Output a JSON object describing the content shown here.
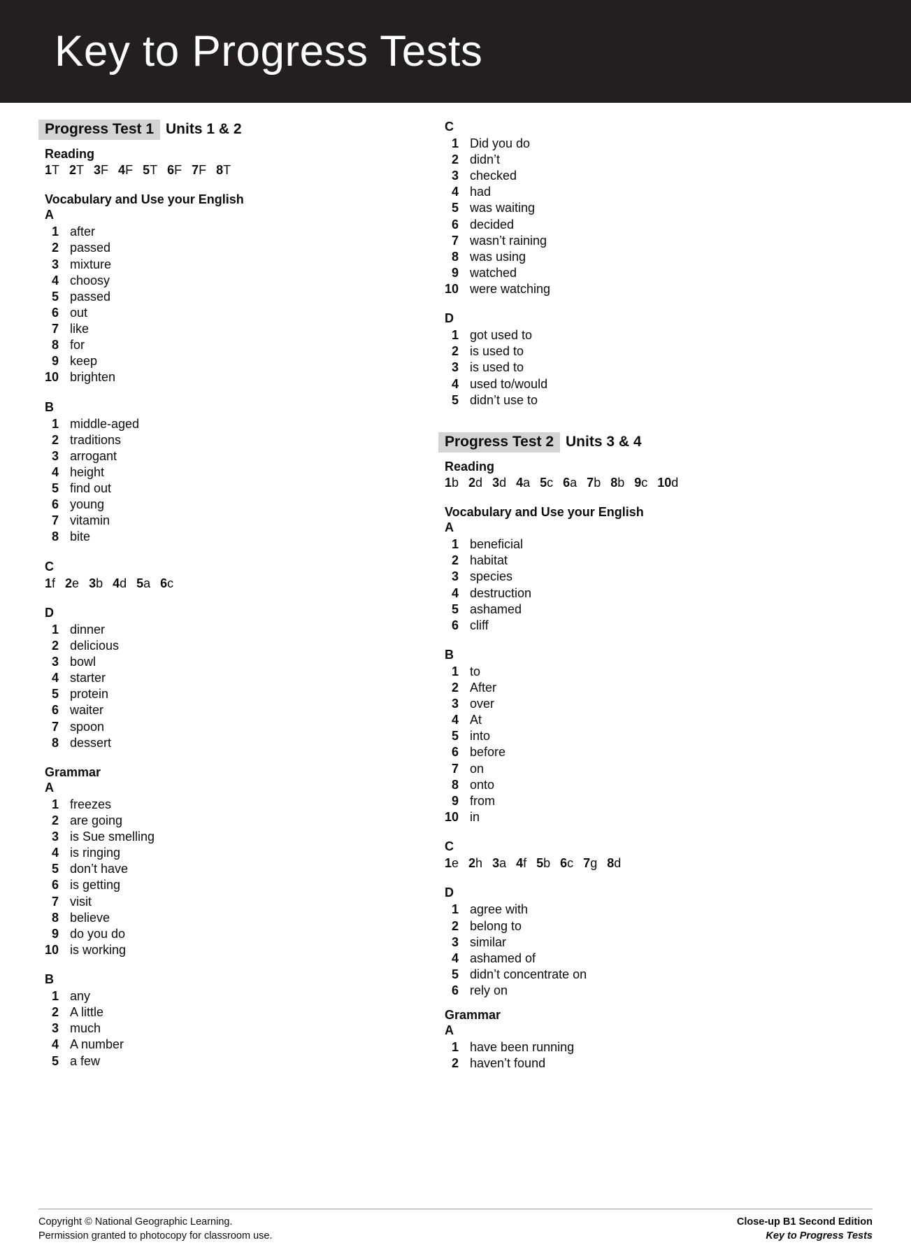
{
  "header": {
    "title": "Key to Progress Tests"
  },
  "tests": [
    {
      "chip": "Progress Test 1",
      "units": "Units 1 & 2",
      "reading_heading": "Reading",
      "reading_answers": [
        {
          "n": "1",
          "a": "T"
        },
        {
          "n": "2",
          "a": "T"
        },
        {
          "n": "3",
          "a": "F"
        },
        {
          "n": "4",
          "a": "F"
        },
        {
          "n": "5",
          "a": "T"
        },
        {
          "n": "6",
          "a": "F"
        },
        {
          "n": "7",
          "a": "F"
        },
        {
          "n": "8",
          "a": "T"
        }
      ],
      "vocab_heading": "Vocabulary and Use your English",
      "vocab_A_letter": "A",
      "vocab_A": [
        {
          "n": "1",
          "a": "after"
        },
        {
          "n": "2",
          "a": "passed"
        },
        {
          "n": "3",
          "a": "mixture"
        },
        {
          "n": "4",
          "a": "choosy"
        },
        {
          "n": "5",
          "a": "passed"
        },
        {
          "n": "6",
          "a": "out"
        },
        {
          "n": "7",
          "a": "like"
        },
        {
          "n": "8",
          "a": "for"
        },
        {
          "n": "9",
          "a": "keep"
        },
        {
          "n": "10",
          "a": "brighten"
        }
      ],
      "vocab_B_letter": "B",
      "vocab_B": [
        {
          "n": "1",
          "a": "middle-aged"
        },
        {
          "n": "2",
          "a": "traditions"
        },
        {
          "n": "3",
          "a": "arrogant"
        },
        {
          "n": "4",
          "a": "height"
        },
        {
          "n": "5",
          "a": "find out"
        },
        {
          "n": "6",
          "a": "young"
        },
        {
          "n": "7",
          "a": "vitamin"
        },
        {
          "n": "8",
          "a": "bite"
        }
      ],
      "vocab_C_letter": "C",
      "vocab_C": [
        {
          "n": "1",
          "a": "f"
        },
        {
          "n": "2",
          "a": "e"
        },
        {
          "n": "3",
          "a": "b"
        },
        {
          "n": "4",
          "a": "d"
        },
        {
          "n": "5",
          "a": "a"
        },
        {
          "n": "6",
          "a": "c"
        }
      ],
      "vocab_D_letter": "D",
      "vocab_D": [
        {
          "n": "1",
          "a": "dinner"
        },
        {
          "n": "2",
          "a": "delicious"
        },
        {
          "n": "3",
          "a": "bowl"
        },
        {
          "n": "4",
          "a": "starter"
        },
        {
          "n": "5",
          "a": "protein"
        },
        {
          "n": "6",
          "a": "waiter"
        },
        {
          "n": "7",
          "a": "spoon"
        },
        {
          "n": "8",
          "a": "dessert"
        }
      ],
      "grammar_heading": "Grammar",
      "grammar_A_letter": "A",
      "grammar_A": [
        {
          "n": "1",
          "a": "freezes"
        },
        {
          "n": "2",
          "a": "are going"
        },
        {
          "n": "3",
          "a": "is Sue smelling"
        },
        {
          "n": "4",
          "a": "is ringing"
        },
        {
          "n": "5",
          "a": "don’t have"
        },
        {
          "n": "6",
          "a": "is getting"
        },
        {
          "n": "7",
          "a": "visit"
        },
        {
          "n": "8",
          "a": "believe"
        },
        {
          "n": "9",
          "a": "do you do"
        },
        {
          "n": "10",
          "a": "is working"
        }
      ],
      "grammar_B_letter": "B",
      "grammar_B": [
        {
          "n": "1",
          "a": "any"
        },
        {
          "n": "2",
          "a": "A little"
        },
        {
          "n": "3",
          "a": "much"
        },
        {
          "n": "4",
          "a": "A number"
        },
        {
          "n": "5",
          "a": "a few"
        }
      ],
      "grammar_C_letter": "C",
      "grammar_C": [
        {
          "n": "1",
          "a": "Did you do"
        },
        {
          "n": "2",
          "a": "didn’t"
        },
        {
          "n": "3",
          "a": "checked"
        },
        {
          "n": "4",
          "a": "had"
        },
        {
          "n": "5",
          "a": "was waiting"
        },
        {
          "n": "6",
          "a": "decided"
        },
        {
          "n": "7",
          "a": "wasn’t raining"
        },
        {
          "n": "8",
          "a": "was using"
        },
        {
          "n": "9",
          "a": "watched"
        },
        {
          "n": "10",
          "a": "were watching"
        }
      ],
      "grammar_D_letter": "D",
      "grammar_D": [
        {
          "n": "1",
          "a": "got used to"
        },
        {
          "n": "2",
          "a": "is used to"
        },
        {
          "n": "3",
          "a": "is used to"
        },
        {
          "n": "4",
          "a": "used to/would"
        },
        {
          "n": "5",
          "a": "didn’t use to"
        }
      ]
    },
    {
      "chip": "Progress Test 2",
      "units": "Units 3 & 4",
      "reading_heading": "Reading",
      "reading_answers": [
        {
          "n": "1",
          "a": "b"
        },
        {
          "n": "2",
          "a": "d"
        },
        {
          "n": "3",
          "a": "d"
        },
        {
          "n": "4",
          "a": "a"
        },
        {
          "n": "5",
          "a": "c"
        },
        {
          "n": "6",
          "a": "a"
        },
        {
          "n": "7",
          "a": "b"
        },
        {
          "n": "8",
          "a": "b"
        },
        {
          "n": "9",
          "a": "c"
        },
        {
          "n": "10",
          "a": "d"
        }
      ],
      "vocab_heading": "Vocabulary and Use your English",
      "vocab_A_letter": "A",
      "vocab_A": [
        {
          "n": "1",
          "a": "beneficial"
        },
        {
          "n": "2",
          "a": "habitat"
        },
        {
          "n": "3",
          "a": "species"
        },
        {
          "n": "4",
          "a": "destruction"
        },
        {
          "n": "5",
          "a": "ashamed"
        },
        {
          "n": "6",
          "a": "cliff"
        }
      ],
      "vocab_B_letter": "B",
      "vocab_B": [
        {
          "n": "1",
          "a": "to"
        },
        {
          "n": "2",
          "a": "After"
        },
        {
          "n": "3",
          "a": "over"
        },
        {
          "n": "4",
          "a": "At"
        },
        {
          "n": "5",
          "a": "into"
        },
        {
          "n": "6",
          "a": "before"
        },
        {
          "n": "7",
          "a": "on"
        },
        {
          "n": "8",
          "a": "onto"
        },
        {
          "n": "9",
          "a": "from"
        },
        {
          "n": "10",
          "a": "in"
        }
      ],
      "vocab_C_letter": "C",
      "vocab_C": [
        {
          "n": "1",
          "a": "e"
        },
        {
          "n": "2",
          "a": "h"
        },
        {
          "n": "3",
          "a": "a"
        },
        {
          "n": "4",
          "a": "f"
        },
        {
          "n": "5",
          "a": "b"
        },
        {
          "n": "6",
          "a": "c"
        },
        {
          "n": "7",
          "a": "g"
        },
        {
          "n": "8",
          "a": "d"
        }
      ],
      "vocab_D_letter": "D",
      "vocab_D": [
        {
          "n": "1",
          "a": "agree with"
        },
        {
          "n": "2",
          "a": "belong to"
        },
        {
          "n": "3",
          "a": "similar"
        },
        {
          "n": "4",
          "a": "ashamed of"
        },
        {
          "n": "5",
          "a": "didn’t concentrate on"
        },
        {
          "n": "6",
          "a": "rely on"
        }
      ],
      "grammar_heading": "Grammar",
      "grammar_A_letter": "A",
      "grammar_A": [
        {
          "n": "1",
          "a": "have been running"
        },
        {
          "n": "2",
          "a": "haven’t found"
        }
      ]
    }
  ],
  "footer": {
    "left_line1": "Copyright © National Geographic Learning.",
    "left_line2": "Permission granted to photocopy for classroom use.",
    "right_line1": "Close-up B1 Second Edition",
    "right_line2": "Key to Progress Tests"
  }
}
